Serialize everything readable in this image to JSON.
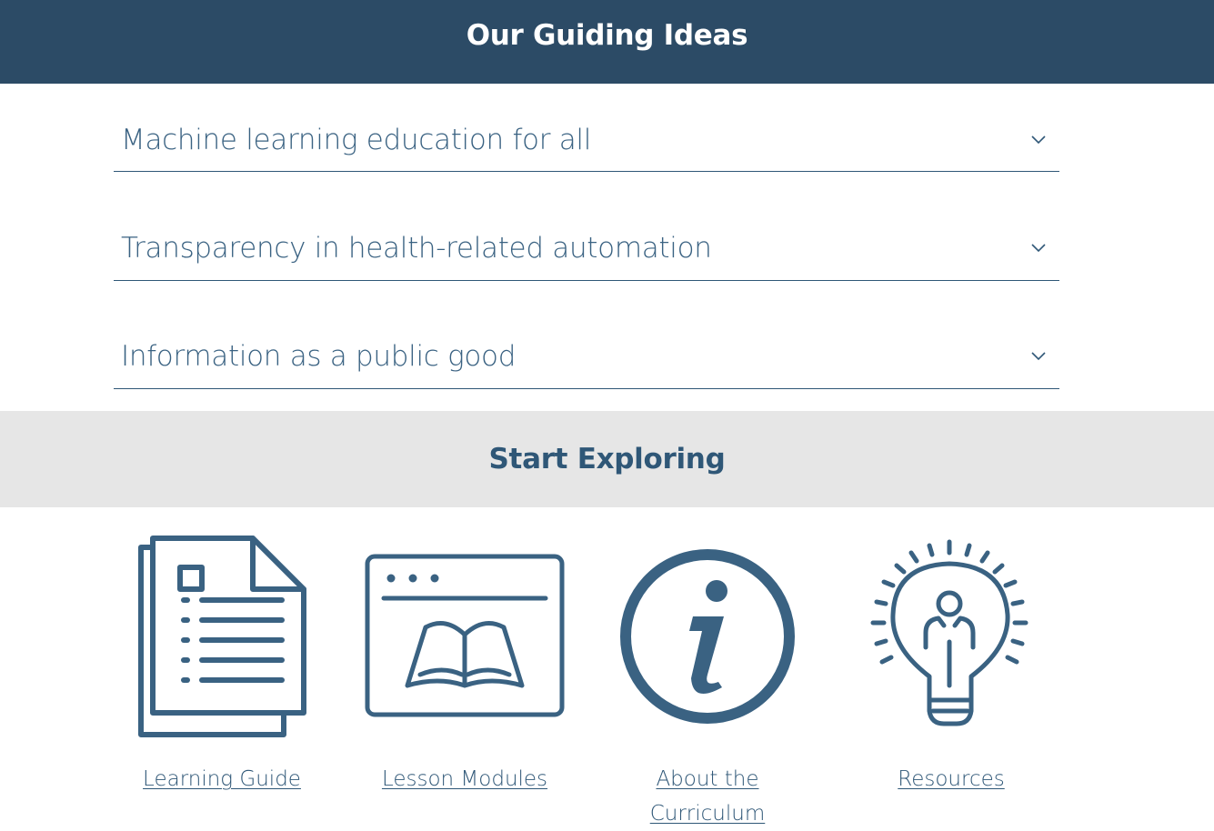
{
  "header": {
    "title": "Our Guiding Ideas"
  },
  "accordion": {
    "items": [
      {
        "label": "Machine learning education for all"
      },
      {
        "label": "Transparency in health-related automation"
      },
      {
        "label": "Information as a public good"
      }
    ]
  },
  "explore": {
    "title": "Start Exploring",
    "links": [
      {
        "label": "Learning Guide",
        "icon": "document-icon"
      },
      {
        "label": "Lesson Modules",
        "icon": "open-book-browser-icon"
      },
      {
        "label": "About the \nCurriculum",
        "icon": "info-icon"
      },
      {
        "label": "Resources",
        "icon": "lightbulb-person-icon"
      }
    ]
  },
  "colors": {
    "header_bg": "#2c4b66",
    "primary": "#2f5777",
    "band_bg": "#e6e6e6"
  }
}
